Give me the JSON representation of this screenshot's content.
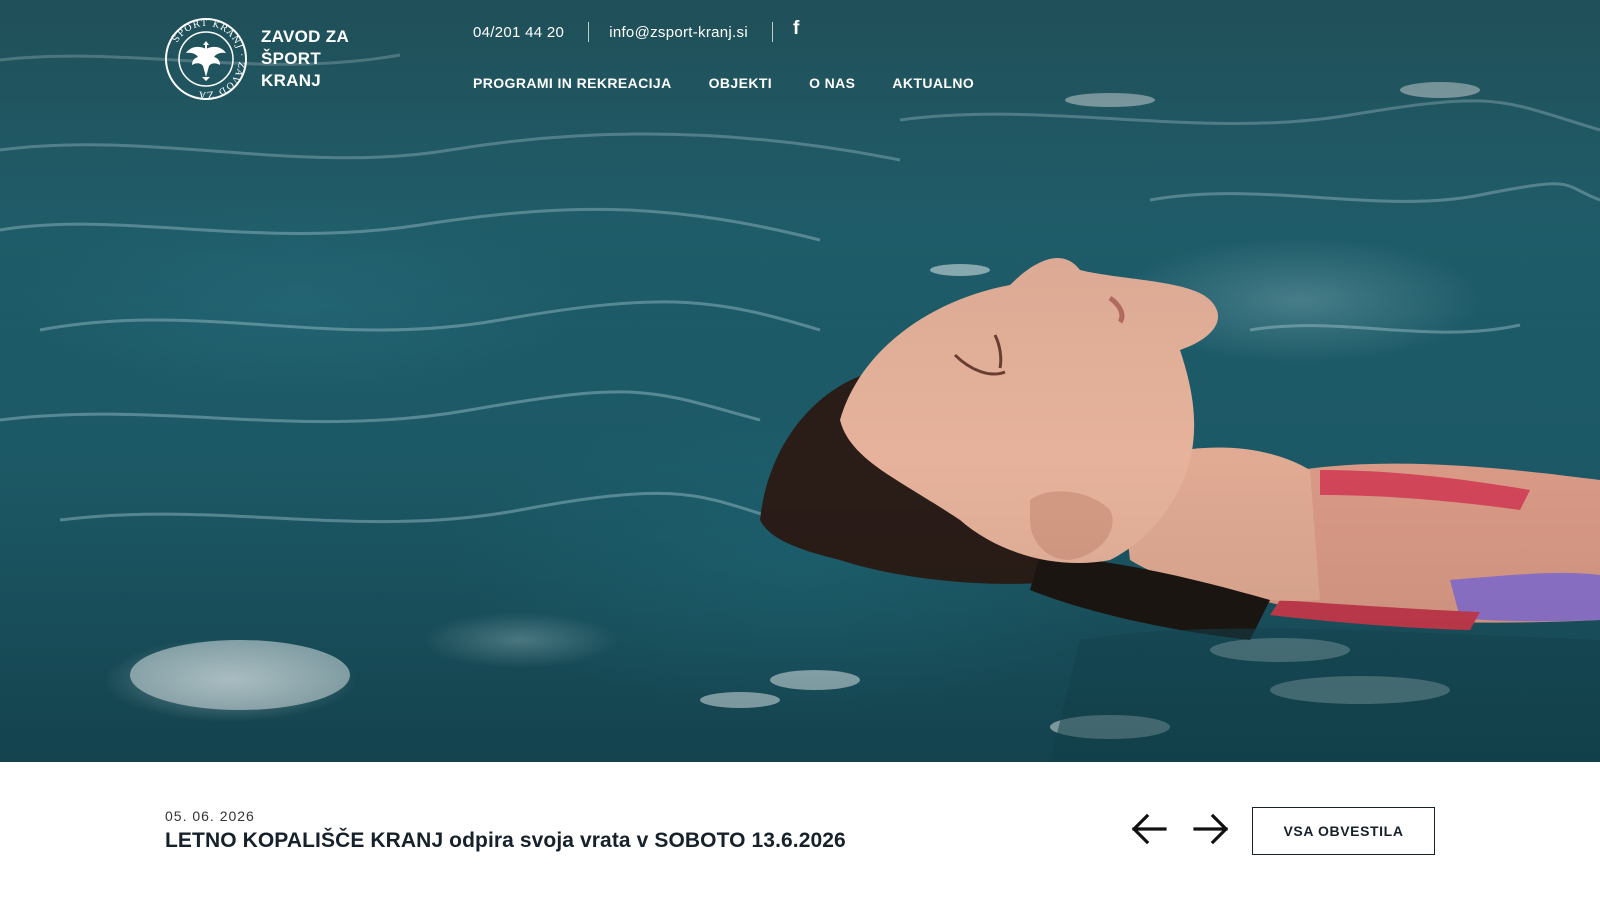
{
  "header": {
    "brand_lines": [
      "ZAVOD ZA",
      "ŠPORT",
      "KRANJ"
    ],
    "logo_ring_text": "ŠPORT KRANJ ZAVOD ZA",
    "phone": "04/201 44 20",
    "email": "info@zsport-kranj.si",
    "social_icon": "facebook-icon",
    "social_glyph": "f"
  },
  "nav": {
    "items": [
      {
        "label": "PROGRAMI IN REKREACIJA"
      },
      {
        "label": "OBJEKTI"
      },
      {
        "label": "O NAS"
      },
      {
        "label": "AKTUALNO"
      }
    ]
  },
  "hero": {
    "image": "woman floating in swimming pool water"
  },
  "news": {
    "date": "05. 06. 2026",
    "title": "LETNO KOPALIŠČE KRANJ odpira svoja vrata v SOBOTO 13.6.2026",
    "prev_icon": "arrow-left-icon",
    "next_icon": "arrow-right-icon",
    "all_button_label": "VSA OBVESTILA"
  },
  "colors": {
    "water": "#1f5f6d",
    "text_dark": "#16212b",
    "white": "#ffffff"
  }
}
